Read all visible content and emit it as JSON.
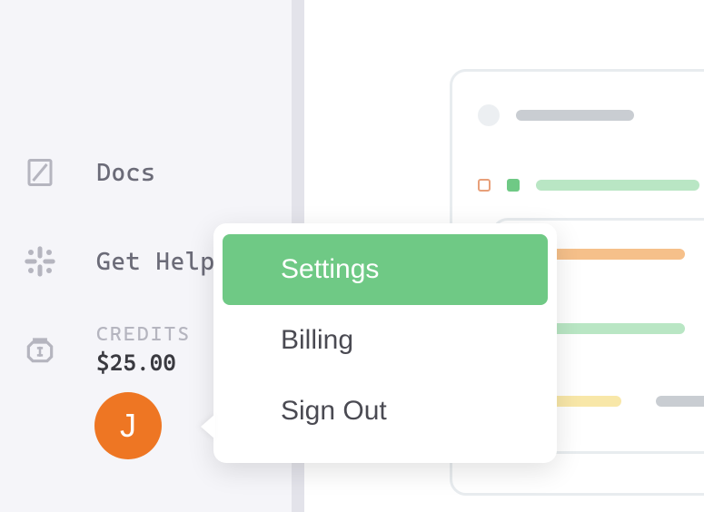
{
  "sidebar": {
    "docs": {
      "label": "Docs"
    },
    "help": {
      "label": "Get Help"
    },
    "credits": {
      "label": "CREDITS",
      "amount": "$25.00"
    }
  },
  "avatar": {
    "letter": "J"
  },
  "popover": {
    "items": [
      {
        "label": "Settings",
        "active": true
      },
      {
        "label": "Billing",
        "active": false
      },
      {
        "label": "Sign Out",
        "active": false
      }
    ]
  }
}
